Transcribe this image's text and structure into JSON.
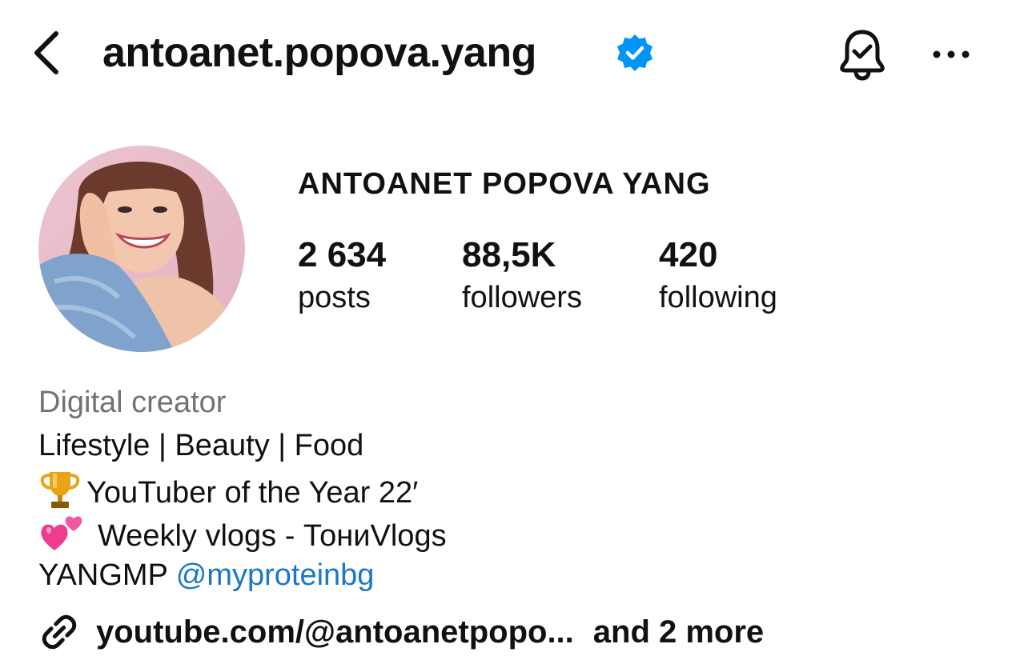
{
  "header": {
    "username": "antoanet.popova.yang",
    "verified": true,
    "back_icon": "chevron-left-icon",
    "bell_icon": "bell-check-icon",
    "more_icon": "more-horizontal-icon",
    "verified_color": "#0095f6"
  },
  "profile": {
    "display_name": "ANTOANET POPOVA YANG",
    "stats": [
      {
        "value": "2 634",
        "label": "posts"
      },
      {
        "value": "88,5K",
        "label": "followers"
      },
      {
        "value": "420",
        "label": "following"
      }
    ]
  },
  "bio": {
    "category": "Digital creator",
    "line1": "Lifestyle | Beauty | Food",
    "line2_emoji": "trophy-emoji",
    "line2": "YouTuber of the Year 22′",
    "line3_emoji": "two-hearts-emoji",
    "line3": "Weekly vlogs - ТониVlogs",
    "line4_prefix": "YANGMP ",
    "line4_mention": "@myproteinbg"
  },
  "link": {
    "icon": "link-icon",
    "text": "youtube.com/@antoanetpopo...",
    "more": "and 2 more"
  },
  "colors": {
    "text": "#111111",
    "secondary_text": "#737373",
    "mention": "#1a77c9",
    "background": "#ffffff"
  }
}
